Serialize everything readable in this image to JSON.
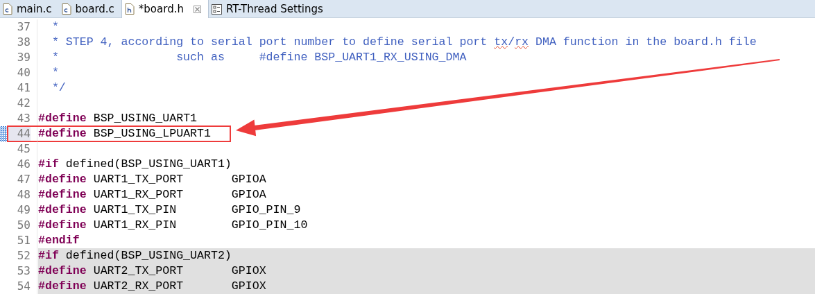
{
  "tabs": [
    {
      "label": "main.c",
      "kind": "c-file",
      "selected": false
    },
    {
      "label": "board.c",
      "kind": "c-file",
      "selected": false
    },
    {
      "label": "*board.h",
      "kind": "h-file",
      "selected": true
    },
    {
      "label": "RT-Thread Settings",
      "kind": "settings",
      "selected": false
    }
  ],
  "editor": {
    "lines": [
      {
        "number": "37",
        "shaded": false,
        "current": false,
        "annotated": false,
        "tokens": [
          {
            "kind": "comment",
            "text": "  *"
          }
        ]
      },
      {
        "number": "38",
        "shaded": false,
        "current": false,
        "annotated": false,
        "tokens": [
          {
            "kind": "comment",
            "text": "  * STEP 4, according to serial port number to define serial port ",
            "misspelled": false
          },
          {
            "kind": "comment",
            "text": "tx",
            "misspelled": true
          },
          {
            "kind": "comment",
            "text": "/",
            "misspelled": false
          },
          {
            "kind": "comment",
            "text": "rx",
            "misspelled": true
          },
          {
            "kind": "comment",
            "text": " DMA function in the board.h file",
            "misspelled": false
          }
        ]
      },
      {
        "number": "39",
        "shaded": false,
        "current": false,
        "annotated": false,
        "tokens": [
          {
            "kind": "comment",
            "text": "  *                 such as     #define BSP_UART1_RX_USING_DMA"
          }
        ]
      },
      {
        "number": "40",
        "shaded": false,
        "current": false,
        "annotated": false,
        "tokens": [
          {
            "kind": "comment",
            "text": "  *"
          }
        ]
      },
      {
        "number": "41",
        "shaded": false,
        "current": false,
        "annotated": false,
        "tokens": [
          {
            "kind": "comment",
            "text": "  */"
          }
        ]
      },
      {
        "number": "42",
        "shaded": false,
        "current": false,
        "annotated": false
      },
      {
        "number": "43",
        "shaded": false,
        "current": false,
        "annotated": false,
        "tokens": [
          {
            "kind": "keyword",
            "text": "#define"
          },
          {
            "kind": "plain",
            "text": " BSP_USING_UART1"
          }
        ]
      },
      {
        "number": "44",
        "shaded": false,
        "current": true,
        "annotated": true,
        "tokens": [
          {
            "kind": "keyword",
            "text": "#define"
          },
          {
            "kind": "plain",
            "text": " BSP_USING_LPUART1"
          }
        ]
      },
      {
        "number": "45",
        "shaded": false,
        "current": false,
        "annotated": false
      },
      {
        "number": "46",
        "shaded": false,
        "current": false,
        "annotated": false,
        "tokens": [
          {
            "kind": "keyword",
            "text": "#if"
          },
          {
            "kind": "plain",
            "text": " defined(BSP_USING_UART1)"
          }
        ]
      },
      {
        "number": "47",
        "shaded": false,
        "current": false,
        "annotated": false,
        "tokens": [
          {
            "kind": "keyword",
            "text": "#define"
          },
          {
            "kind": "plain",
            "text": " UART1_TX_PORT       GPIOA"
          }
        ]
      },
      {
        "number": "48",
        "shaded": false,
        "current": false,
        "annotated": false,
        "tokens": [
          {
            "kind": "keyword",
            "text": "#define"
          },
          {
            "kind": "plain",
            "text": " UART1_RX_PORT       GPIOA"
          }
        ]
      },
      {
        "number": "49",
        "shaded": false,
        "current": false,
        "annotated": false,
        "tokens": [
          {
            "kind": "keyword",
            "text": "#define"
          },
          {
            "kind": "plain",
            "text": " UART1_TX_PIN        GPIO_PIN_9"
          }
        ]
      },
      {
        "number": "50",
        "shaded": false,
        "current": false,
        "annotated": false,
        "tokens": [
          {
            "kind": "keyword",
            "text": "#define"
          },
          {
            "kind": "plain",
            "text": " UART1_RX_PIN        GPIO_PIN_10"
          }
        ]
      },
      {
        "number": "51",
        "shaded": false,
        "current": false,
        "annotated": false,
        "tokens": [
          {
            "kind": "keyword",
            "text": "#endif"
          }
        ]
      },
      {
        "number": "52",
        "shaded": true,
        "current": false,
        "annotated": false,
        "tokens": [
          {
            "kind": "keyword",
            "text": "#if"
          },
          {
            "kind": "plain",
            "text": " defined(BSP_USING_UART2)"
          }
        ]
      },
      {
        "number": "53",
        "shaded": true,
        "current": false,
        "annotated": false,
        "tokens": [
          {
            "kind": "keyword",
            "text": "#define"
          },
          {
            "kind": "plain",
            "text": " UART2_TX_PORT       GPIOX"
          }
        ]
      },
      {
        "number": "54",
        "shaded": true,
        "current": false,
        "annotated": false,
        "tokens": [
          {
            "kind": "keyword",
            "text": "#define"
          },
          {
            "kind": "plain",
            "text": " UART2_RX_PORT       GPIOX"
          }
        ]
      }
    ]
  }
}
